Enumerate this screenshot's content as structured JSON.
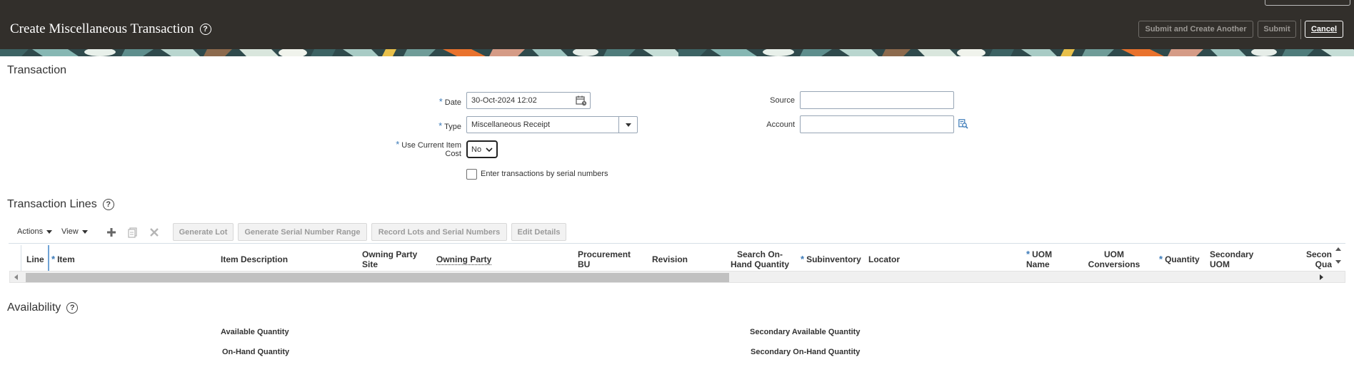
{
  "header": {
    "title": "Create Miscellaneous Transaction",
    "submit_create_another_label": "Submit and Create Another",
    "submit_label": "Submit",
    "cancel_label": "Cancel"
  },
  "transaction": {
    "title": "Transaction",
    "date_label": "Date",
    "date_value": "30-Oct-2024 12:02",
    "type_label": "Type",
    "type_value": "Miscellaneous Receipt",
    "use_current_item_cost_label_1": "Use Current Item",
    "use_current_item_cost_label_2": "Cost",
    "use_current_item_cost_value": "No",
    "serial_checkbox_label": "Enter transactions by serial numbers",
    "source_label": "Source",
    "source_value": "",
    "account_label": "Account",
    "account_value": ""
  },
  "transaction_lines": {
    "title": "Transaction Lines",
    "toolbar": {
      "actions_label": "Actions",
      "view_label": "View",
      "generate_lot_label": "Generate Lot",
      "generate_serial_label": "Generate Serial Number Range",
      "record_lots_label": "Record Lots and Serial Numbers",
      "edit_details_label": "Edit Details"
    },
    "columns": {
      "line": "Line",
      "item": "Item",
      "item_description": "Item Description",
      "owning_party_site_1": "Owning Party",
      "owning_party_site_2": "Site",
      "owning_party": "Owning Party",
      "procurement_bu_1": "Procurement",
      "procurement_bu_2": "BU",
      "revision": "Revision",
      "search_onhand_1": "Search On-",
      "search_onhand_2": "Hand Quantity",
      "subinventory": "Subinventory",
      "locator": "Locator",
      "uom_name_1": "UOM",
      "uom_name_2": "Name",
      "uom_conversions_1": "UOM",
      "uom_conversions_2": "Conversions",
      "quantity": "Quantity",
      "secondary_uom_1": "Secondary",
      "secondary_uom_2": "UOM",
      "secondary_qty_1": "Secon",
      "secondary_qty_2": "Qua"
    }
  },
  "availability": {
    "title": "Availability",
    "available_quantity_label": "Available Quantity",
    "onhand_quantity_label": "On-Hand Quantity",
    "secondary_available_label": "Secondary Available Quantity",
    "secondary_onhand_label": "Secondary On-Hand Quantity"
  },
  "colors": {
    "header_bg": "#322f2b",
    "required_marker": "#3b7ab8",
    "input_border": "#97a5b5"
  },
  "icons": {
    "page_help": "help-circle-icon",
    "date_picker": "calendar-icon",
    "account_search": "search-icon",
    "add_row": "plus-icon",
    "duplicate_row": "duplicate-icon",
    "delete_row": "delete-icon"
  }
}
